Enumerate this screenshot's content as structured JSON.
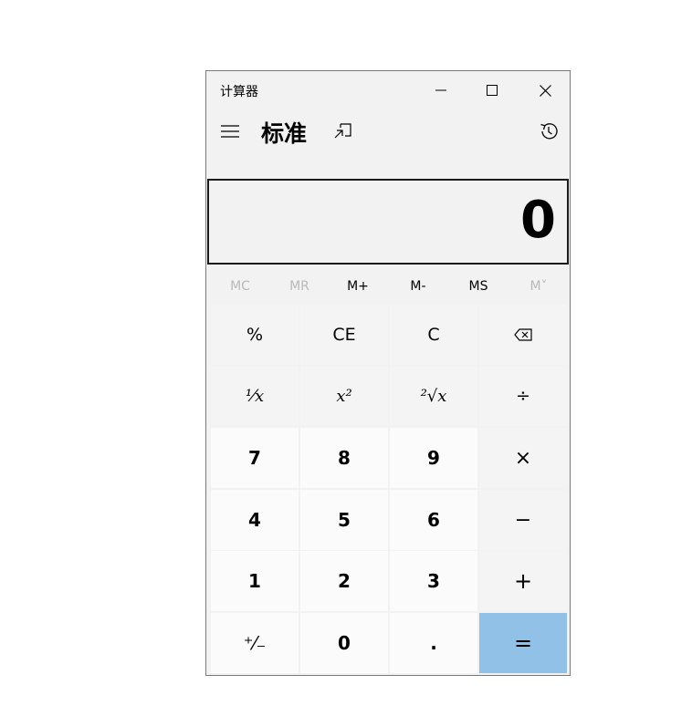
{
  "window": {
    "title": "计算器",
    "minimize_icon": "minimize-icon",
    "maximize_icon": "maximize-icon",
    "close_icon": "close-icon"
  },
  "header": {
    "mode": "标准",
    "menu_icon": "hamburger-icon",
    "keep_on_top_icon": "keep-on-top-icon",
    "history_icon": "history-icon"
  },
  "display": {
    "value": "0"
  },
  "memory": {
    "mc": "MC",
    "mr": "MR",
    "mplus": "M+",
    "mminus": "M-",
    "ms": "MS",
    "mlist": "M˅"
  },
  "keys": {
    "percent": "%",
    "ce": "CE",
    "c": "C",
    "backspace_icon": "backspace-icon",
    "reciprocal": "¹⁄x",
    "square": "x²",
    "sqrt": "²√x",
    "divide": "÷",
    "seven": "7",
    "eight": "8",
    "nine": "9",
    "multiply": "×",
    "four": "4",
    "five": "5",
    "six": "6",
    "minus": "−",
    "one": "1",
    "two": "2",
    "three": "3",
    "plus": "+",
    "negate": "⁺⁄₋",
    "zero": "0",
    "decimal": ".",
    "equals": "="
  },
  "colors": {
    "background": "#f2f2f2",
    "equals_key": "#92c1e7",
    "digit_key": "#fbfbfb",
    "function_key": "#f4f4f4"
  }
}
